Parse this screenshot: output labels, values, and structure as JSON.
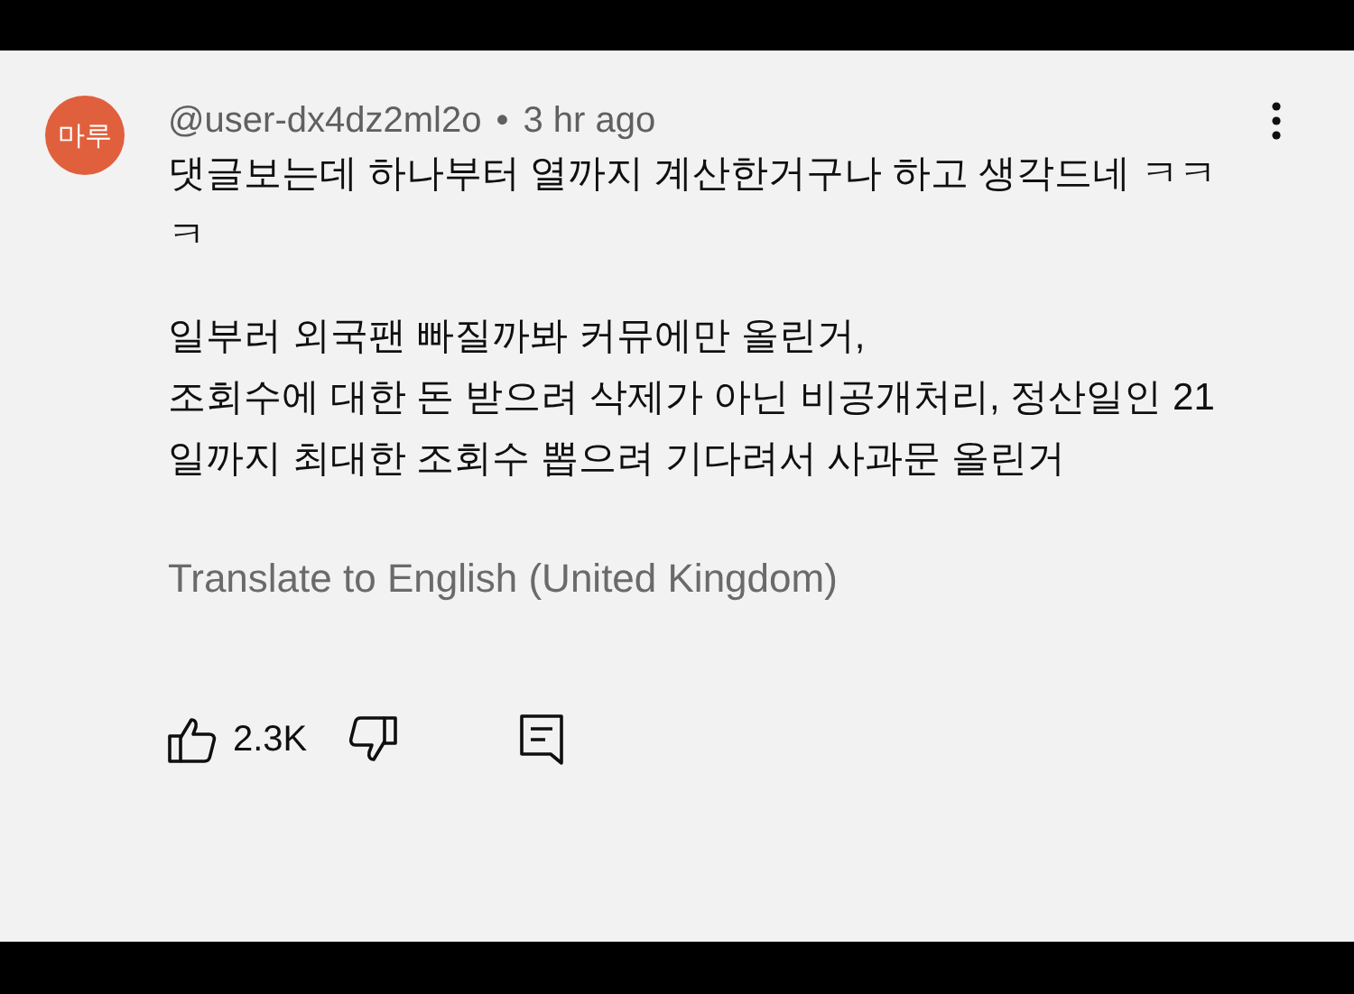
{
  "comment": {
    "avatar_text": "마루",
    "author": "@user-dx4dz2ml2o",
    "separator": "•",
    "time": "3 hr ago",
    "paragraphs": [
      "댓글보는데 하나부터 열까지 계산한거구나 하고 생각드네 ㅋㅋㅋ",
      "일부러 외국팬 빠질까봐 커뮤에만 올린거,\n조회수에 대한 돈 받으려 삭제가 아닌 비공개처리, 정산일인 21일까지 최대한 조회수 뽑으려 기다려서 사과문 올린거"
    ],
    "translate": "Translate to English (United Kingdom)",
    "likes": "2.3K"
  }
}
